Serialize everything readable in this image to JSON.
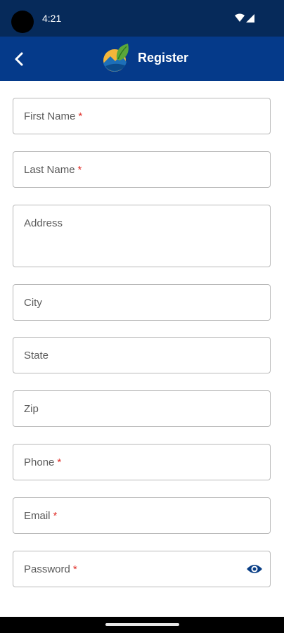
{
  "status_bar": {
    "time": "4:21",
    "icons": [
      "wifi-icon",
      "signal-icon"
    ]
  },
  "app_bar": {
    "title": "Register",
    "back_icon": "back-chevron-icon",
    "logo": "leaf-mountain-logo"
  },
  "colors": {
    "status_bar_bg": "#062a5a",
    "app_bar_bg": "#053a8a",
    "required_marker": "#e0302a",
    "eye_icon": "#0a3f86"
  },
  "form": {
    "fields": [
      {
        "label": "First Name",
        "required": "*"
      },
      {
        "label": "Last Name",
        "required": "*"
      },
      {
        "label": "Address",
        "required": ""
      },
      {
        "label": "City",
        "required": ""
      },
      {
        "label": "State",
        "required": ""
      },
      {
        "label": "Zip",
        "required": ""
      },
      {
        "label": "Phone",
        "required": "*"
      },
      {
        "label": "Email",
        "required": "*"
      },
      {
        "label": "Password",
        "required": "*",
        "trailing_icon": "eye-icon"
      }
    ]
  }
}
